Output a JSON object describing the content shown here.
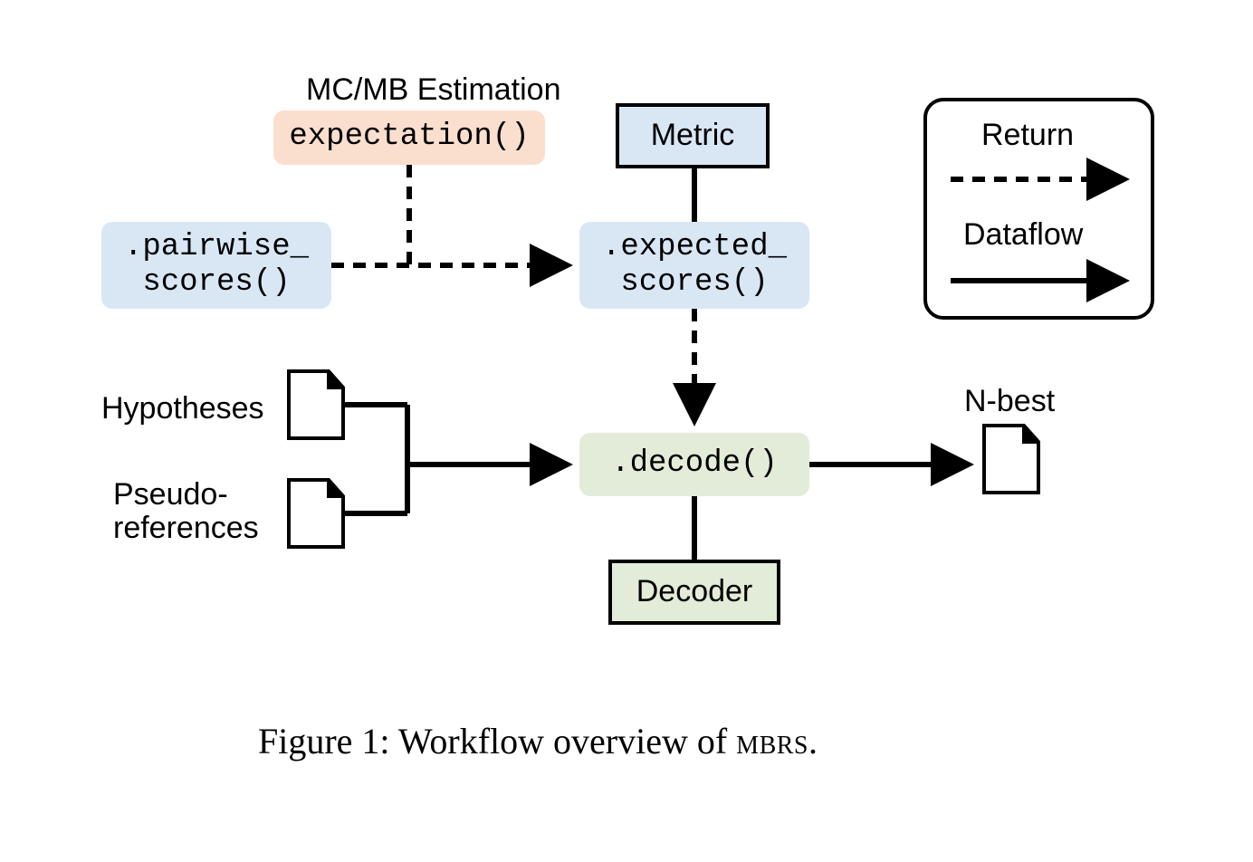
{
  "nodes": {
    "estimation_title": "MC/MB Estimation",
    "expectation": "expectation()",
    "metric": "Metric",
    "pairwise": ".pairwise_\nscores()",
    "expected": ".expected_\nscores()",
    "hypotheses": "Hypotheses",
    "pseudo": "Pseudo-\nreferences",
    "decode": ".decode()",
    "decoder": "Decoder",
    "nbest": "N-best"
  },
  "legend": {
    "return": "Return",
    "dataflow": "Dataflow"
  },
  "caption": {
    "prefix": "Figure 1: Workflow overview of ",
    "system": "mbrs",
    "suffix": "."
  }
}
